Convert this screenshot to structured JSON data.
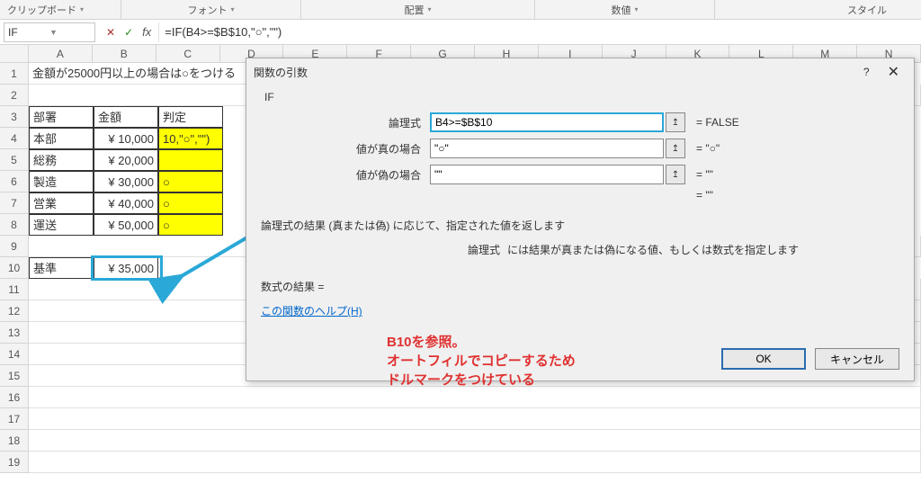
{
  "ribbon": {
    "clipboard": "クリップボード",
    "font": "フォント",
    "alignment": "配置",
    "number": "数値",
    "style": "スタイル"
  },
  "nameBox": "IF",
  "formula": "=IF(B4>=$B$10,\"○\",\"\")",
  "columns": [
    "A",
    "B",
    "C",
    "D",
    "E",
    "F",
    "G",
    "H",
    "I",
    "J",
    "K",
    "L",
    "M",
    "N"
  ],
  "rows": [
    "1",
    "2",
    "3",
    "4",
    "5",
    "6",
    "7",
    "8",
    "9",
    "10",
    "11",
    "12",
    "13",
    "14",
    "15",
    "16",
    "17",
    "18",
    "19"
  ],
  "sheet": {
    "a1": "金額が25000円以上の場合は○をつける",
    "header": {
      "a3": "部署",
      "b3": "金額",
      "c3": "判定"
    },
    "data": [
      {
        "a": "本部",
        "b": "¥ 10,000",
        "c": "10,\"○\",\"\")"
      },
      {
        "a": "総務",
        "b": "¥ 20,000",
        "c": ""
      },
      {
        "a": "製造",
        "b": "¥ 30,000",
        "c": "○"
      },
      {
        "a": "営業",
        "b": "¥ 40,000",
        "c": "○"
      },
      {
        "a": "運送",
        "b": "¥ 50,000",
        "c": "○"
      }
    ],
    "a10": "基準",
    "b10": "¥ 35,000"
  },
  "dialog": {
    "title": "関数の引数",
    "funcName": "IF",
    "args": {
      "logical_label": "論理式",
      "logical_value": "B4>=$B$10",
      "logical_result": "FALSE",
      "true_label": "値が真の場合",
      "true_value": "\"○\"",
      "true_result": "\"○\"",
      "false_label": "値が偽の場合",
      "false_value": "\"\"",
      "false_result": "\"\"",
      "final_result": "\"\""
    },
    "desc": "論理式の結果 (真または偽) に応じて、指定された値を返します",
    "desc2_label": "論理式",
    "desc2_text": "には結果が真または偽になる値、もしくは数式を指定します",
    "resultLabel": "数式の結果 =",
    "helpLink": "この関数のヘルプ(H)",
    "ok": "OK",
    "cancel": "キャンセル"
  },
  "annotation": {
    "line1": "B10を参照。",
    "line2": "オートフィルでコピーするため",
    "line3": "ドルマークをつけている"
  }
}
